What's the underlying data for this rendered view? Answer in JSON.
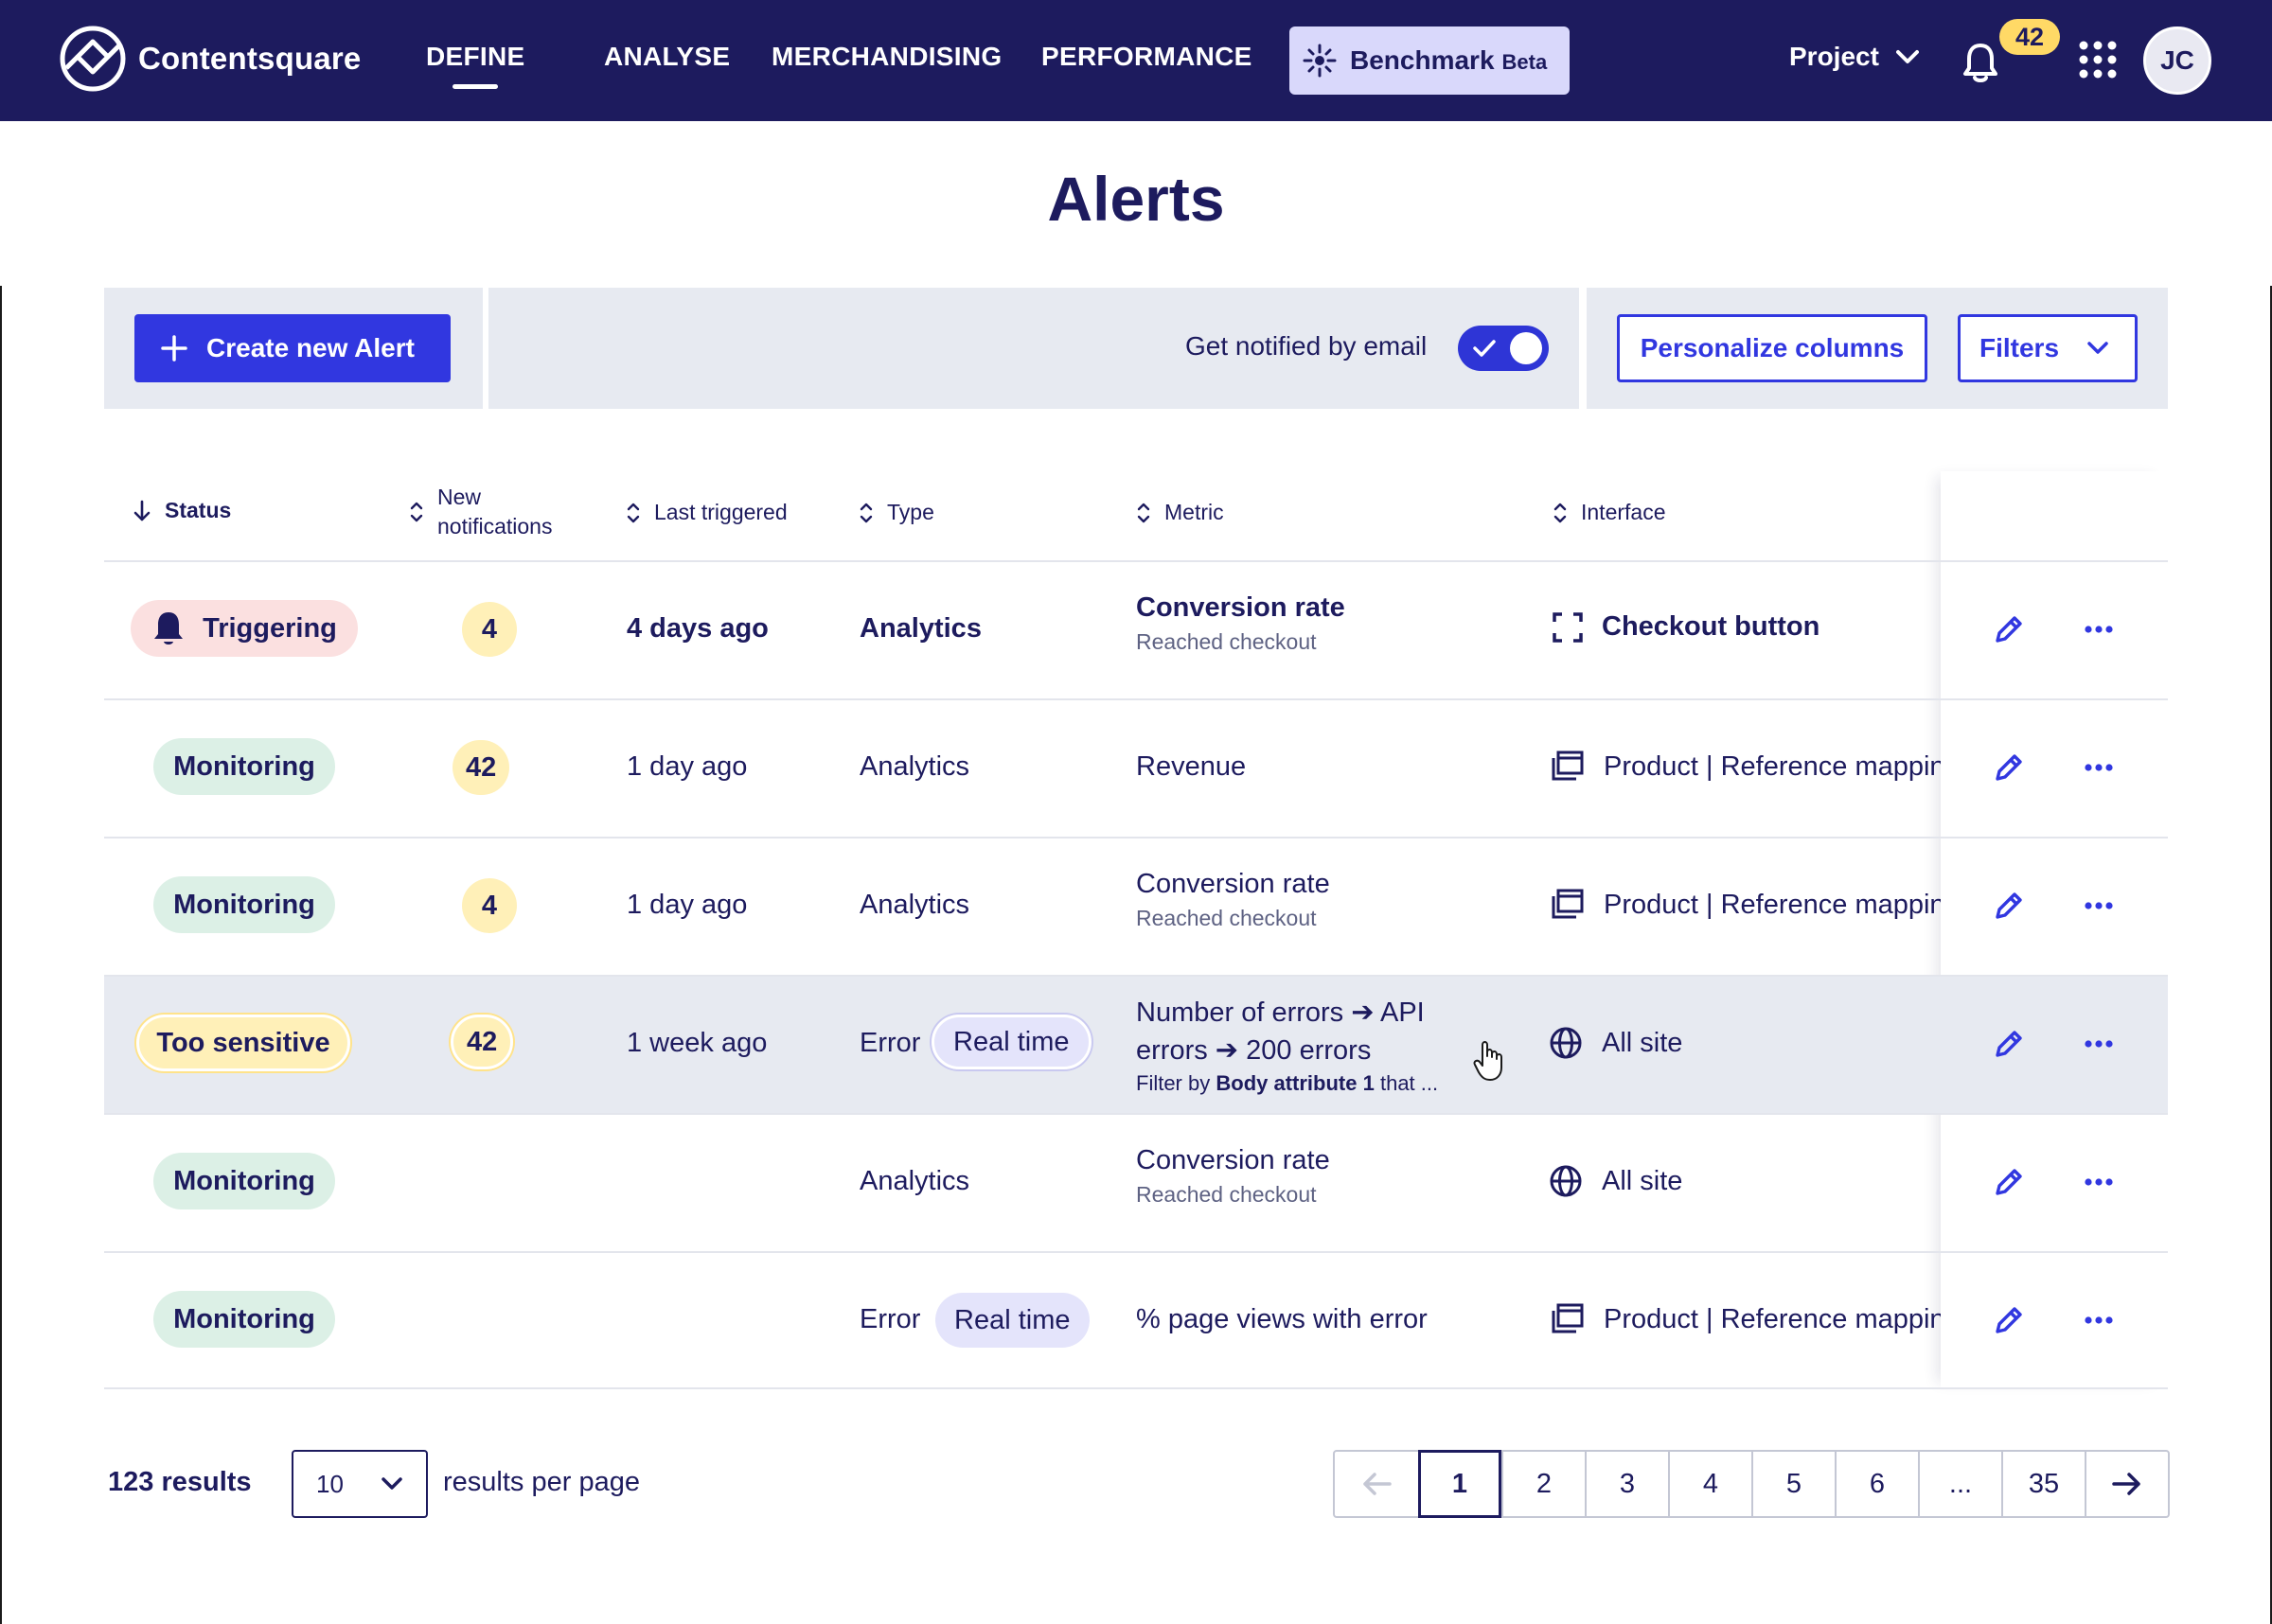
{
  "nav": {
    "brand": "Contentsquare",
    "items": [
      "DEFINE",
      "ANALYSE",
      "MERCHANDISING",
      "PERFORMANCE"
    ],
    "active": "DEFINE",
    "benchmark": {
      "label": "Benchmark",
      "badge": "Beta"
    },
    "project": "Project",
    "notifications": "42",
    "avatar": "JC"
  },
  "page": {
    "title": "Alerts"
  },
  "toolbar": {
    "create_label": "Create new Alert",
    "email_label": "Get notified by email",
    "email_enabled": true,
    "personalize_label": "Personalize columns",
    "filters_label": "Filters"
  },
  "table": {
    "headers": {
      "status": "Status",
      "new_notifications_line1": "New",
      "new_notifications_line2": "notifications",
      "last_triggered": "Last triggered",
      "type": "Type",
      "metric": "Metric",
      "interface": "Interface"
    },
    "rows": [
      {
        "status": "Triggering",
        "count": "4",
        "last": "4 days ago",
        "type": "Analytics",
        "metric": "Conversion rate",
        "metric_sub": "Reached checkout",
        "interface": "Checkout button"
      },
      {
        "status": "Monitoring",
        "count": "42",
        "last": "1 day ago",
        "type": "Analytics",
        "metric": "Revenue",
        "interface": "Product | Reference mapping"
      },
      {
        "status": "Monitoring",
        "count": "4",
        "last": "1 day ago",
        "type": "Analytics",
        "metric": "Conversion rate",
        "metric_sub": "Reached checkout",
        "interface": "Product | Reference mapping"
      },
      {
        "status": "Too sensitive",
        "count": "42",
        "last": "1 week ago",
        "type": "Error",
        "tag": "Real time",
        "metric_line1": "Number of errors ➔ API",
        "metric_line2": "errors ➔ 200 errors",
        "filter_prefix": "Filter by",
        "filter_attr": "Body attribute 1",
        "filter_suffix": "that ...",
        "interface": "All site"
      },
      {
        "status": "Monitoring",
        "type": "Analytics",
        "metric": "Conversion rate",
        "metric_sub": "Reached checkout",
        "interface": "All site"
      },
      {
        "status": "Monitoring",
        "type": "Error",
        "tag": "Real time",
        "metric": "% page views with error",
        "interface": "Product | Reference mapping"
      }
    ]
  },
  "footer": {
    "results": "123 results",
    "per_page_value": "10",
    "per_page_label": "results per page",
    "pages": [
      "1",
      "2",
      "3",
      "4",
      "5",
      "6",
      "...",
      "35"
    ],
    "current_page": "1"
  },
  "colors": {
    "nav_bg": "#1d1b5e",
    "primary": "#3137e0",
    "toolbar_bg": "#e7eaf1",
    "triggering": "#fbe0e0",
    "monitoring": "#dcf0e6",
    "too_sensitive": "#fff0b8",
    "real_time_tag": "#e4e4fb"
  },
  "icons": {
    "brand": "contentsquare-logo-icon",
    "benchmark": "sparkle-icon",
    "project": "chevron-down-icon",
    "notifications": "bell-icon",
    "apps": "apps-grid-icon",
    "create": "plus-icon",
    "toggle": "check-icon",
    "sort_active": "arrow-down-icon",
    "sort": "sort-icon",
    "triggering": "bell-icon",
    "interface_zone": "zone-selection-icon",
    "interface_page": "page-group-icon",
    "interface_site": "globe-icon",
    "edit": "pencil-icon",
    "more": "more-horizontal-icon",
    "prev": "arrow-left-icon",
    "next": "arrow-right-icon"
  }
}
